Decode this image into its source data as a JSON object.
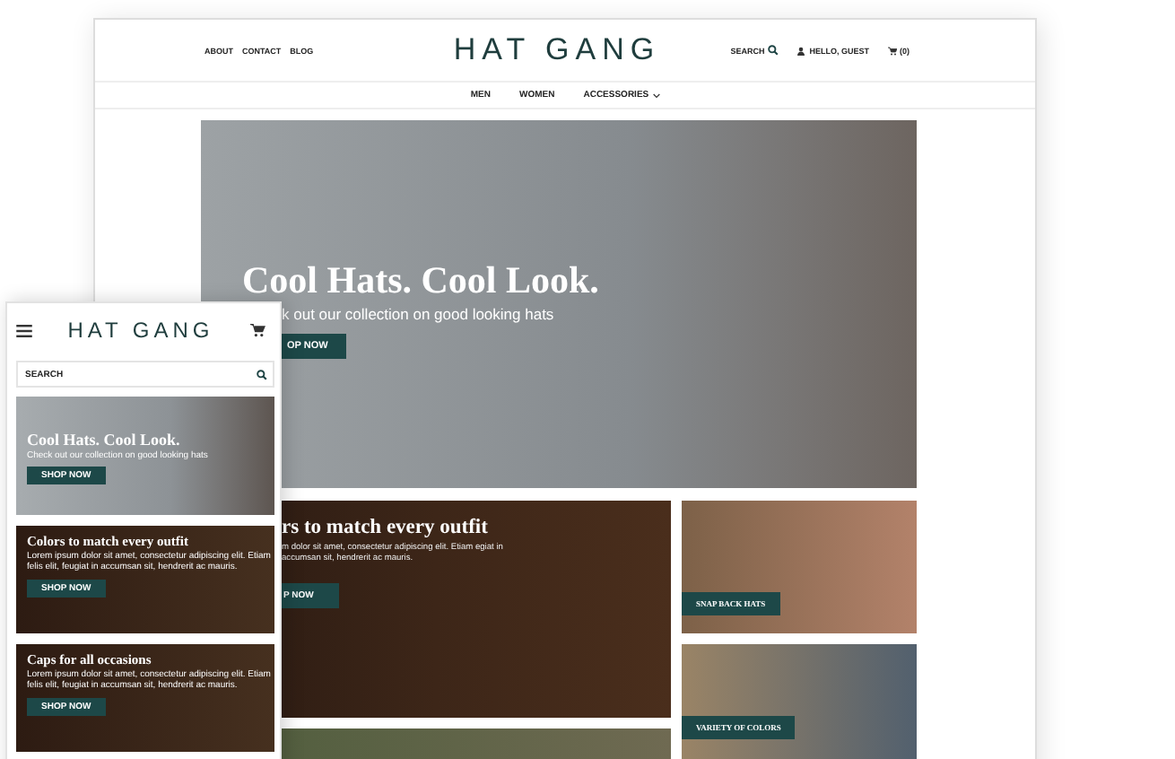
{
  "desktop": {
    "top_links": [
      "ABOUT",
      "CONTACT",
      "BLOG"
    ],
    "logo": "HAT GANG",
    "search_label": "SEARCH",
    "account_label": "HELLO, GUEST",
    "cart_count": "(0)",
    "nav": [
      {
        "label": "MEN",
        "kind": "link"
      },
      {
        "label": "WOMEN",
        "kind": "link"
      },
      {
        "label": "ACCESSORIES",
        "kind": "dropdown"
      }
    ],
    "hero": {
      "title": "Cool Hats. Cool Look.",
      "subtitle": "k out our collection on good looking hats",
      "button": "OP NOW"
    },
    "promo": {
      "title": "rs to match every outfit",
      "text": "m dolor sit amet, consectetur adipiscing elit. Etiam egiat in accumsan sit, hendrerit ac mauris.",
      "button": "P NOW"
    },
    "tiles": [
      {
        "label": "SNAP BACK HATS"
      },
      {
        "label": "VARIETY OF COLORS"
      }
    ]
  },
  "mobile": {
    "logo": "HAT GANG",
    "search_placeholder": "SEARCH",
    "cards": [
      {
        "kind": "hero",
        "title": "Cool Hats. Cool Look.",
        "text": "Check out our collection on good looking hats",
        "button": "SHOP NOW"
      },
      {
        "kind": "promo",
        "title": "Colors to match every outfit",
        "text": "Lorem ipsum dolor sit amet, consectetur adipiscing elit. Etiam felis elit, feugiat in accumsan sit, hendrerit ac mauris.",
        "button": "SHOP NOW"
      },
      {
        "kind": "promo",
        "title": "Caps for all occasions",
        "text": "Lorem ipsum dolor sit amet, consectetur adipiscing elit. Etiam felis elit, feugiat in accumsan sit, hendrerit ac mauris.",
        "button": "SHOP NOW"
      }
    ]
  }
}
